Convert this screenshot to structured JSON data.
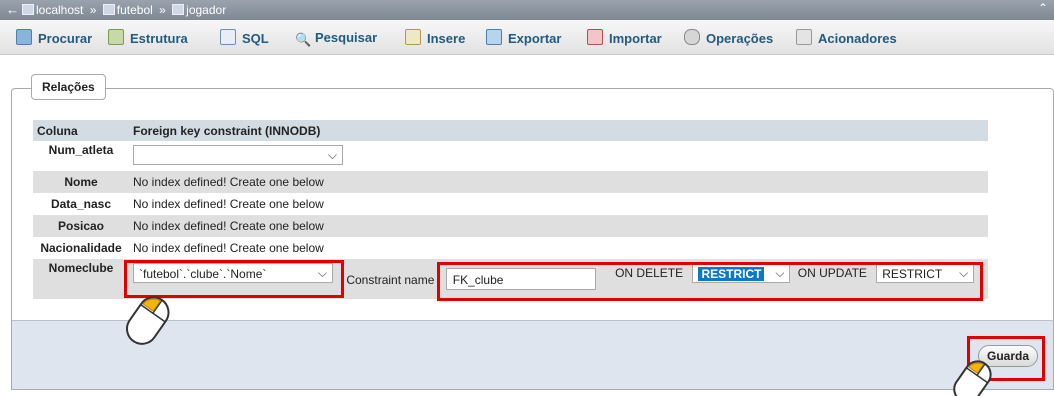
{
  "breadcrumb": {
    "server": "localhost",
    "database": "futebol",
    "table": "jogador",
    "sep": "»"
  },
  "tabs": [
    {
      "label": "Procurar",
      "icon": "browse-icon"
    },
    {
      "label": "Estrutura",
      "icon": "structure-icon"
    },
    {
      "label": "SQL",
      "icon": "sql-icon"
    },
    {
      "label": "Pesquisar",
      "icon": "search-icon"
    },
    {
      "label": "Insere",
      "icon": "insert-icon"
    },
    {
      "label": "Exportar",
      "icon": "export-icon"
    },
    {
      "label": "Importar",
      "icon": "import-icon"
    },
    {
      "label": "Operações",
      "icon": "operations-icon"
    },
    {
      "label": "Acionadores",
      "icon": "triggers-icon"
    }
  ],
  "section": {
    "legend": "Relações"
  },
  "table": {
    "headers": [
      "Coluna",
      "Foreign key constraint (INNODB)"
    ],
    "no_index": "No index defined! Create one below",
    "rows": [
      "Num_atleta",
      "Nome",
      "Data_nasc",
      "Posicao",
      "Nacionalidade",
      "Nomeclube"
    ],
    "fk_value": "`futebol`.`clube`.`Nome`",
    "constraint_label": "Constraint name",
    "constraint_value": "FK_clube",
    "on_delete_label": "ON DELETE",
    "on_delete_value": "RESTRICT",
    "on_update_label": "ON UPDATE",
    "on_update_value": "RESTRICT"
  },
  "buttons": {
    "save": "Guarda"
  },
  "colors": {
    "highlight": "#e00000",
    "link": "#235a81",
    "selected": "#0b78c8"
  }
}
